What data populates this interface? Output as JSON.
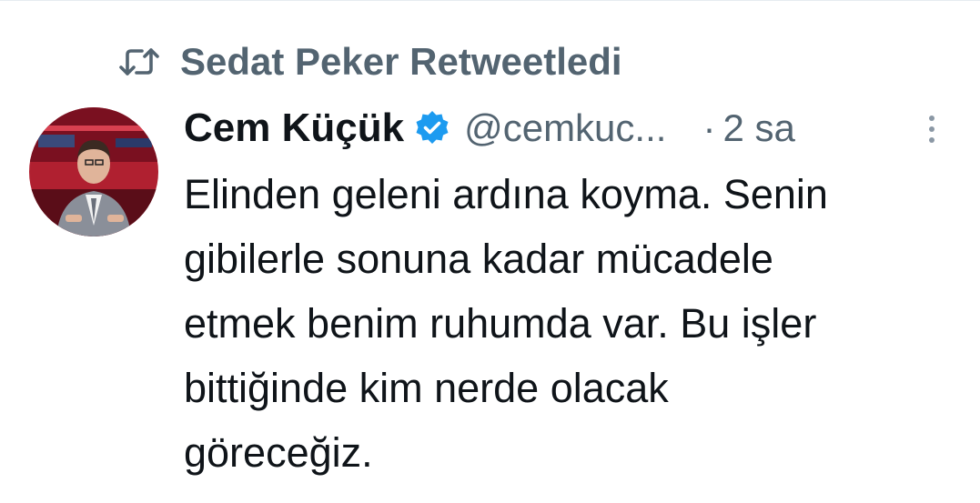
{
  "retweet": {
    "label": "Sedat Peker Retweetledi",
    "icon": "retweet-icon"
  },
  "tweet": {
    "author_name": "Cem Küçük",
    "verified": true,
    "handle": "@cemkuc...",
    "separator": "·",
    "time": "2 sa",
    "text": "Elinden geleni ardına koyma. Senin\ngibilerle sonuna kadar mücadele\netmek benim ruhumda var. Bu işler\nbittiğinde kim nerde olacak\ngöreceğiz."
  },
  "icons": {
    "avatar": "avatar-photo",
    "verified": "verified-badge-icon",
    "more": "more-vertical-icon"
  },
  "colors": {
    "text_primary": "#0f1419",
    "text_secondary": "#536471",
    "verified_blue": "#1d9bf0",
    "background": "#ffffff"
  }
}
